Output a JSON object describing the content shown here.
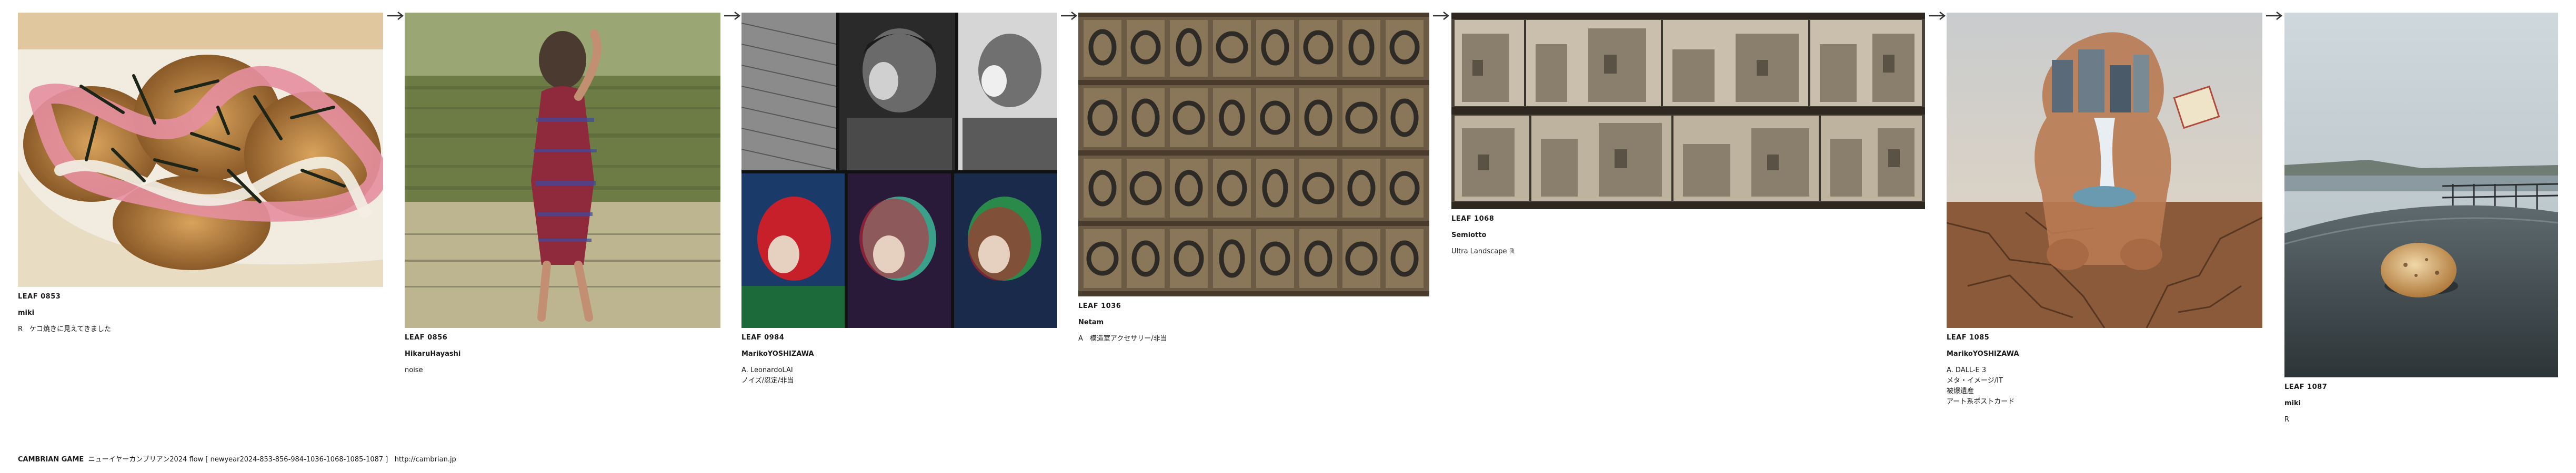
{
  "leaves": [
    {
      "leaf_no": "LEAF 0853",
      "author": "miki",
      "lines": [
        "R　ケコ焼きに見えてきました"
      ]
    },
    {
      "leaf_no": "LEAF 0856",
      "author": "HikaruHayashi",
      "lines": [
        "noise"
      ]
    },
    {
      "leaf_no": "LEAF 0984",
      "author": "MarikoYOSHIZAWA",
      "lines": [
        "A. LeonardoLAI",
        "ノイズ/忍定/非当"
      ]
    },
    {
      "leaf_no": "LEAF 1036",
      "author": "Netam",
      "lines": [
        "A　模造室アクセサリー/非当"
      ]
    },
    {
      "leaf_no": "LEAF 1068",
      "author": "Semiotto",
      "lines": [
        "Ultra Landscape ℝ"
      ]
    },
    {
      "leaf_no": "LEAF 1085",
      "author": "MarikoYOSHIZAWA",
      "lines": [
        "A. DALL-E 3",
        "メタ・イメージ/IT",
        "被爆遺産",
        "アート系ポストカード"
      ]
    },
    {
      "leaf_no": "LEAF 1087",
      "author": "miki",
      "lines": [
        "R"
      ]
    }
  ],
  "footer": {
    "game": "CAMBRIAN GAME",
    "text": "ニューイヤーカンブリアン2024  flow [ newyear2024-853-856-984-1036-1068-1085-1087 ]",
    "url": "http://cambrian.jp"
  },
  "icons": {
    "arrow": "right-arrow-icon"
  }
}
